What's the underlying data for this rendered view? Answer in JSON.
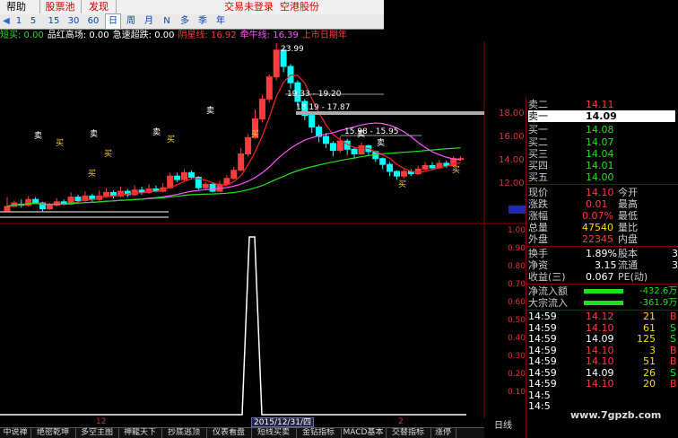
{
  "toolbar": {
    "help": "帮助",
    "stock_pool": "股票池",
    "discover": "发现",
    "status": "交易未登录",
    "stock_name": "空港股份"
  },
  "periods": [
    "1",
    "5",
    "15",
    "30",
    "60",
    "日",
    "周",
    "月",
    "N",
    "多",
    "季",
    "年"
  ],
  "selected_period": "日",
  "indicator_line": [
    {
      "text": "短买: 0.00",
      "color": "#1fe01f"
    },
    {
      "text": "品红高场: 0.00",
      "color": "#ffffff"
    },
    {
      "text": "急速超跌: 0.00",
      "color": "#ffffff"
    },
    {
      "text": "阴星线: 16.92",
      "color": "#ff3b3b"
    },
    {
      "text": "牵牛线: 16.39",
      "color": "#ff55ff"
    },
    {
      "text": "上市日期年",
      "color": "#ff3b3b"
    }
  ],
  "chart_annotations": {
    "peak": "23.99",
    "range1": "19.33 - 19.20",
    "range2": "18.19 - 17.87",
    "range3": "15.98 - 15.95"
  },
  "buy_sell_labels": [
    "卖",
    "买",
    "卖",
    "买",
    "卖",
    "买",
    "卖",
    "买",
    "买",
    "卖",
    "买",
    "卖",
    "买"
  ],
  "price_axis": [
    "18.00",
    "16.00",
    "14.00",
    "12.00"
  ],
  "ind_axis": [
    "1.00",
    "0.90",
    "0.80",
    "0.70",
    "0.60",
    "0.50",
    "0.40",
    "0.30",
    "0.20",
    "0.10"
  ],
  "quote": {
    "ask2_label": "卖二",
    "ask2": "14.11",
    "ask1_label": "卖一",
    "ask1": "14.09",
    "bid1_label": "买一",
    "bid1": "14.08",
    "bid2_label": "买二",
    "bid2": "14.07",
    "bid3_label": "买三",
    "bid3": "14.04",
    "bid4_label": "买四",
    "bid4": "14.01",
    "bid5_label": "买五",
    "bid5": "14.00",
    "now_label": "现价",
    "now": "14.10",
    "open_label": "今开",
    "chg_label": "涨跌",
    "chg": "0.01",
    "high_label": "最高",
    "pct_label": "涨幅",
    "pct": "0.07%",
    "low_label": "最低",
    "vol_label": "总量",
    "vol": "47540",
    "vr_label": "量比",
    "outer_label": "外盘",
    "outer": "22345",
    "inner_label": "内盘",
    "turn_label": "换手",
    "turn": "1.89%",
    "cap_label": "股本",
    "cap_val": "3",
    "nav_label": "净资",
    "nav": "3.15",
    "float_label": "流通",
    "float_val": "3",
    "eps_label": "收益(三)",
    "eps": "0.067",
    "pe_label": "PE(动)",
    "netin_label": "净流入额",
    "netin": "-432.6万",
    "bigin_label": "大宗流入",
    "bigin": "-361.9万"
  },
  "ticks": [
    {
      "time": "14:59",
      "price": "14.12",
      "vol": "21",
      "side": "B"
    },
    {
      "time": "14:59",
      "price": "14.10",
      "vol": "61",
      "side": "S"
    },
    {
      "time": "14:59",
      "price": "14.09",
      "vol": "125",
      "side": "S"
    },
    {
      "time": "14:59",
      "price": "14.10",
      "vol": "3",
      "side": "B"
    },
    {
      "time": "14:59",
      "price": "14.10",
      "vol": "51",
      "side": "B"
    },
    {
      "time": "14:59",
      "price": "14.09",
      "vol": "26",
      "side": "S"
    },
    {
      "time": "14:59",
      "price": "14.10",
      "vol": "20",
      "side": "B"
    },
    {
      "time": "14:5",
      "price": "",
      "vol": "",
      "side": ""
    },
    {
      "time": "14:5",
      "price": "",
      "vol": "",
      "side": ""
    }
  ],
  "dates": {
    "d1": "12",
    "d2": "2015/12/31/四",
    "d3": "2"
  },
  "day_line": "日线",
  "tabs": [
    "中说禅",
    "绝密乾坤",
    "多空主图",
    "神龍天下",
    "抄底逃顶",
    "仪表看盘",
    "短线买卖",
    "金钻指标",
    "MACD基本",
    "交替指标",
    "涨停"
  ],
  "watermark": "www.7gpzb.com",
  "colors": {
    "up": "#ff3b3b",
    "down": "#00ffff",
    "ma1": "#ff2020",
    "ma2": "#ff55ff",
    "ma3": "#1fe01f"
  }
}
